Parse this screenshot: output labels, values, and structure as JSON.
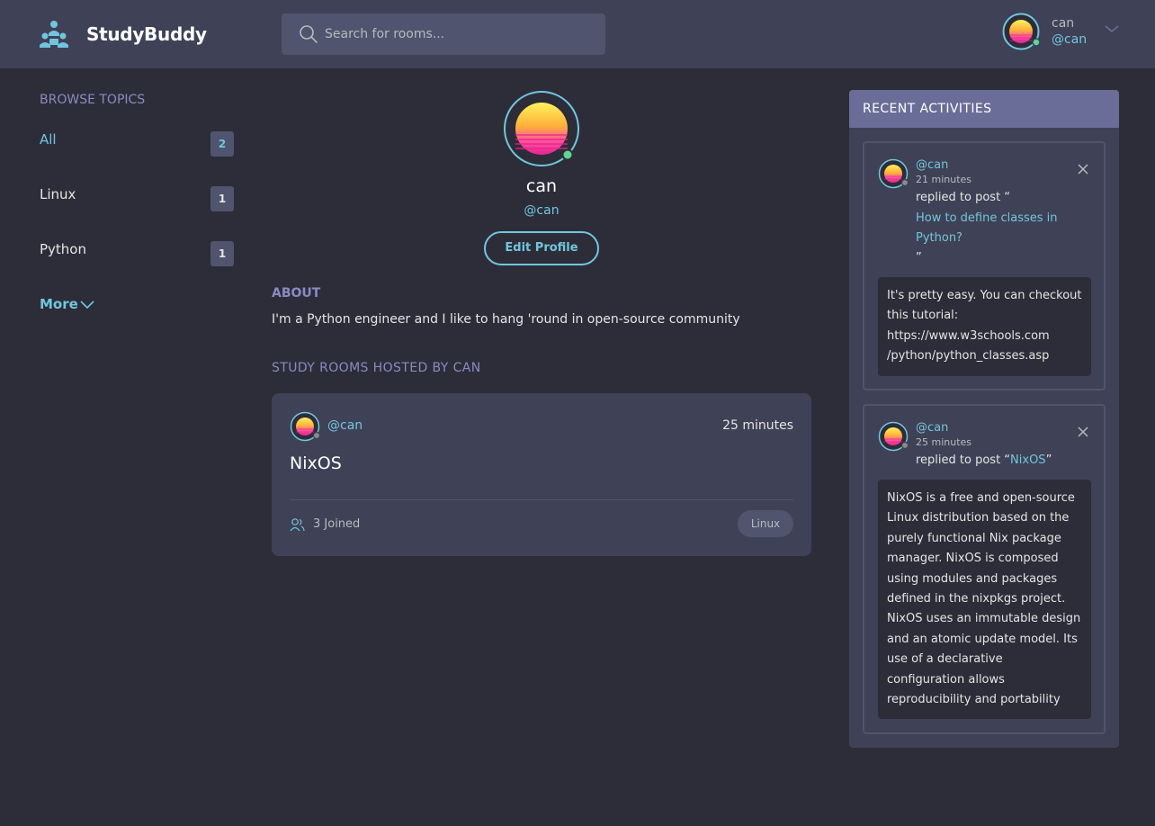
{
  "header": {
    "app_name": "StudyBuddy",
    "search_placeholder": "Search for rooms...",
    "user_name": "can",
    "user_handle": "@can"
  },
  "topics": {
    "title": "Browse Topics",
    "items": [
      {
        "label": "All",
        "count": "2",
        "active": true
      },
      {
        "label": "Linux",
        "count": "1"
      },
      {
        "label": "Python",
        "count": "1"
      }
    ],
    "more_label": "More"
  },
  "profile": {
    "name": "can",
    "handle": "@can",
    "edit_label": "Edit Profile",
    "about_title": "About",
    "about_text": "I'm a Python engineer and I like to hang 'round in open-source community",
    "rooms_title": "Study Rooms Hosted by can"
  },
  "room": {
    "host": "@can",
    "time": "25 minutes",
    "name": "NixOS",
    "joined": "3 Joined",
    "tag": "Linux"
  },
  "activities": {
    "title": "Recent Activities",
    "items": [
      {
        "handle": "@can",
        "time": "21 minutes",
        "action": "replied to post “",
        "link_line1": "How to define classes in",
        "link_line2": "Python?",
        "close_quote": "”",
        "body": [
          "It's pretty easy. You can checkout",
          "this tutorial:",
          "https://www.w3schools.com",
          "/python/python_classes.asp"
        ]
      },
      {
        "handle": "@can",
        "time": "25 minutes",
        "action": "replied to post “",
        "link": "NixOS",
        "close_quote": "”",
        "body": [
          "NixOS is a free and open-source",
          "Linux distribution based on the",
          "purely functional Nix package",
          "manager. NixOS is composed",
          "using modules and packages",
          "defined in the nixpkgs project.",
          "NixOS uses an immutable design",
          "and an atomic update model. Its",
          "use of a declarative",
          "configuration allows",
          "reproducibility and portability"
        ]
      }
    ]
  },
  "colors": {
    "background": "#2d2d39",
    "header": "#3f4156",
    "accent": "#71c6dd",
    "muted_purple": "#8b8ac1",
    "activities_header": "#696d97",
    "online": "#5dd693"
  },
  "icons": [
    "logo-icon",
    "search-icon",
    "chevron-down-icon",
    "users-icon",
    "close-icon"
  ]
}
